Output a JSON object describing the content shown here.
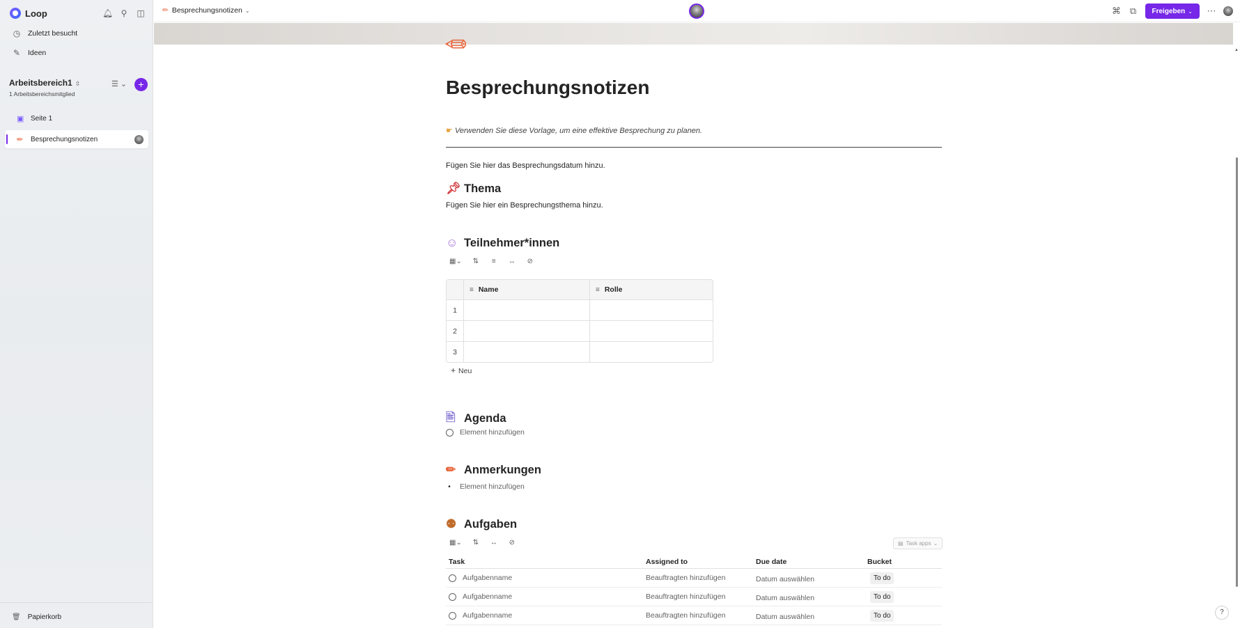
{
  "app": {
    "name": "Loop"
  },
  "sidebar": {
    "nav": [
      {
        "label": "Zuletzt besucht",
        "icon": "clock-icon"
      },
      {
        "label": "Ideen",
        "icon": "pen-square-icon"
      }
    ],
    "workspace": {
      "title": "Arbeitsbereich1",
      "members": "1 Arbeitsbereichsmitglied"
    },
    "pages": [
      {
        "label": "Seite 1",
        "icon": "page-icon"
      },
      {
        "label": "Besprechungsnotizen",
        "icon": "pencil-icon"
      }
    ],
    "trash_label": "Papierkorb"
  },
  "topbar": {
    "breadcrumb": "Besprechungsnotizen",
    "share_label": "Freigeben",
    "accent": "#7627e8"
  },
  "page": {
    "title": "Besprechungsnotizen",
    "intro": "Verwenden Sie diese Vorlage, um eine effektive Besprechung zu planen.",
    "date_placeholder": "Fügen Sie hier das Besprechungsdatum hinzu.",
    "topic": {
      "heading": "Thema",
      "text": "Fügen Sie hier ein Besprechungsthema hinzu."
    },
    "participants": {
      "heading": "Teilnehmer*innen",
      "columns": [
        "Name",
        "Rolle"
      ],
      "rows": [
        "1",
        "2",
        "3"
      ],
      "new_label": "Neu"
    },
    "agenda": {
      "heading": "Agenda",
      "item_placeholder": "Element hinzufügen"
    },
    "notes": {
      "heading": "Anmerkungen",
      "item_placeholder": "Element hinzufügen"
    },
    "tasks": {
      "heading": "Aufgaben",
      "task_apps_label": "Task apps",
      "columns": {
        "task": "Task",
        "assigned": "Assigned to",
        "due": "Due date",
        "bucket": "Bucket"
      },
      "rows": [
        {
          "task": "Aufgabenname",
          "assigned": "Beauftragten hinzufügen",
          "due": "Datum auswählen",
          "bucket": "To do"
        },
        {
          "task": "Aufgabenname",
          "assigned": "Beauftragten hinzufügen",
          "due": "Datum auswählen",
          "bucket": "To do"
        },
        {
          "task": "Aufgabenname",
          "assigned": "Beauftragten hinzufügen",
          "due": "Datum auswählen",
          "bucket": "To do"
        }
      ]
    }
  }
}
